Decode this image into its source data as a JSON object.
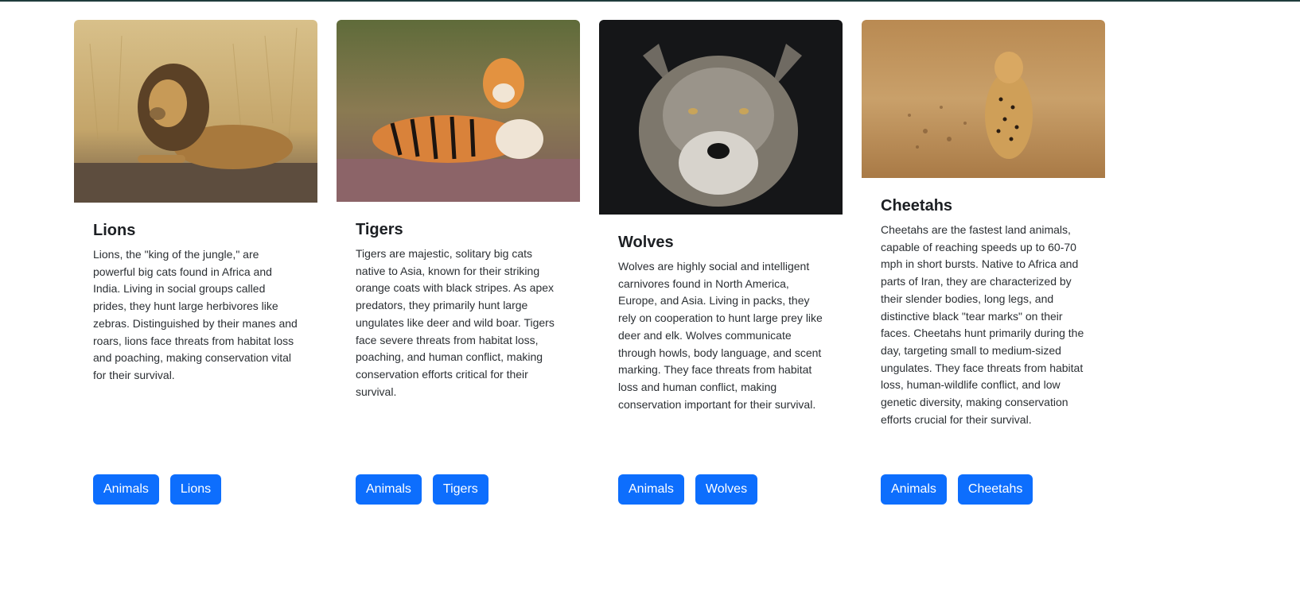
{
  "cards": [
    {
      "title": "Lions",
      "text": "Lions, the \"king of the jungle,\" are powerful big cats found in Africa and India. Living in social groups called prides, they hunt large herbivores like zebras. Distinguished by their manes and roars, lions face threats from habitat loss and poaching, making conservation vital for their survival.",
      "tags": [
        "Animals",
        "Lions"
      ]
    },
    {
      "title": "Tigers",
      "text": "Tigers are majestic, solitary big cats native to Asia, known for their striking orange coats with black stripes. As apex predators, they primarily hunt large ungulates like deer and wild boar. Tigers face severe threats from habitat loss, poaching, and human conflict, making conservation efforts critical for their survival.",
      "tags": [
        "Animals",
        "Tigers"
      ]
    },
    {
      "title": "Wolves",
      "text": "Wolves are highly social and intelligent carnivores found in North America, Europe, and Asia. Living in packs, they rely on cooperation to hunt large prey like deer and elk. Wolves communicate through howls, body language, and scent marking. They face threats from habitat loss and human conflict, making conservation important for their survival.",
      "tags": [
        "Animals",
        "Wolves"
      ]
    },
    {
      "title": "Cheetahs",
      "text": "Cheetahs are the fastest land animals, capable of reaching speeds up to 60-70 mph in short bursts. Native to Africa and parts of Iran, they are characterized by their slender bodies, long legs, and distinctive black \"tear marks\" on their faces. Cheetahs hunt primarily during the day, targeting small to medium-sized ungulates. They face threats from habitat loss, human-wildlife conflict, and low genetic diversity, making conservation efforts crucial for their survival.",
      "tags": [
        "Animals",
        "Cheetahs"
      ]
    }
  ],
  "colors": {
    "button": "#0d6efd",
    "button_text": "#ffffff"
  }
}
